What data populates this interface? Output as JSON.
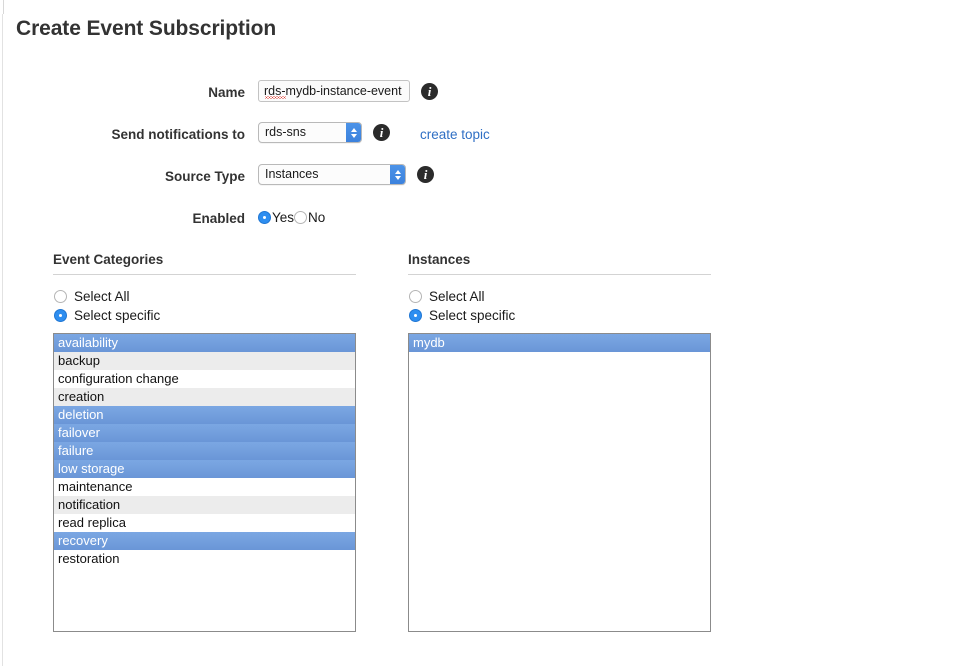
{
  "page": {
    "title": "Create Event Subscription"
  },
  "form": {
    "rows": [
      {
        "label": "Name"
      },
      {
        "label": "Send notifications to"
      },
      {
        "label": "Source Type"
      },
      {
        "label": "Enabled"
      }
    ],
    "name_field": {
      "value": "rds-mydb-instance-event",
      "placeholder": ""
    },
    "sns_select": {
      "value": "rds-sns",
      "options": [
        "rds-sns"
      ]
    },
    "source_type_select": {
      "value": "Instances",
      "options": [
        "Instances"
      ]
    },
    "enabled": {
      "yes_label": "Yes",
      "no_label": "No",
      "selected": "Yes"
    },
    "create_topic_link": "create topic",
    "info_icon_glyph": "i"
  },
  "panels": {
    "event_categories": {
      "title": "Event Categories",
      "select_all_label": "Select All",
      "select_specific_label": "Select specific",
      "mode": "Select specific",
      "items": [
        {
          "label": "availability",
          "selected": true
        },
        {
          "label": "backup",
          "selected": false
        },
        {
          "label": "configuration change",
          "selected": false
        },
        {
          "label": "creation",
          "selected": false
        },
        {
          "label": "deletion",
          "selected": true
        },
        {
          "label": "failover",
          "selected": true
        },
        {
          "label": "failure",
          "selected": true
        },
        {
          "label": "low storage",
          "selected": true
        },
        {
          "label": "maintenance",
          "selected": false
        },
        {
          "label": "notification",
          "selected": false
        },
        {
          "label": "read replica",
          "selected": false
        },
        {
          "label": "recovery",
          "selected": true
        },
        {
          "label": "restoration",
          "selected": false
        }
      ]
    },
    "instances": {
      "title": "Instances",
      "select_all_label": "Select All",
      "select_specific_label": "Select specific",
      "mode": "Select specific",
      "items": [
        {
          "label": "mydb",
          "selected": true
        }
      ]
    }
  },
  "colors": {
    "accent_blue": "#2e8ef0",
    "link_blue": "#2f6fc4",
    "selection_blue_top": "#7ba7e3",
    "selection_blue_bottom": "#6a96d7",
    "zebra_gray": "#ececec",
    "text": "#333333",
    "border": "#8b8b8b"
  }
}
